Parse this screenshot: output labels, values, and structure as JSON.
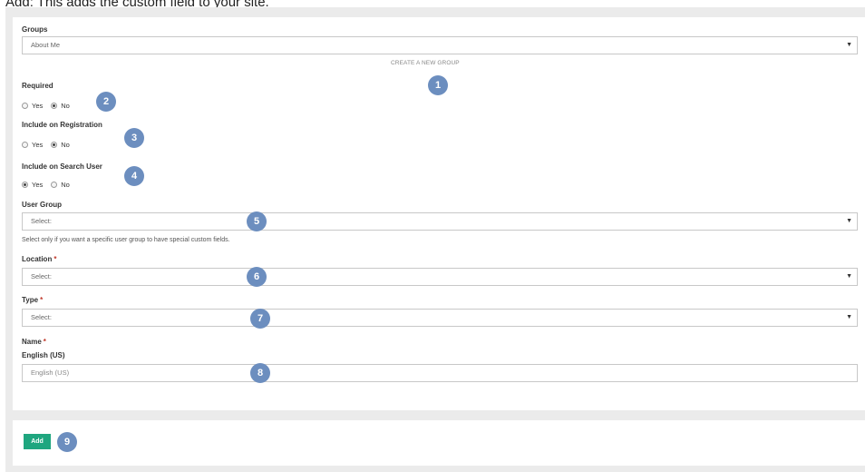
{
  "caption": "Add: This adds the custom field to your site.",
  "groups": {
    "label": "Groups",
    "selected": "About Me",
    "create_link": "CREATE A NEW GROUP"
  },
  "required": {
    "label": "Required",
    "options": [
      "Yes",
      "No"
    ],
    "selected": "No"
  },
  "include_registration": {
    "label": "Include on Registration",
    "options": [
      "Yes",
      "No"
    ],
    "selected": "No"
  },
  "include_search": {
    "label": "Include on Search User",
    "options": [
      "Yes",
      "No"
    ],
    "selected": "Yes"
  },
  "user_group": {
    "label": "User Group",
    "selected": "Select:",
    "help": "Select only if you want a specific user group to have special custom fields."
  },
  "location": {
    "label": "Location",
    "required_mark": "*",
    "selected": "Select:"
  },
  "type": {
    "label": "Type",
    "required_mark": "*",
    "selected": "Select:"
  },
  "name": {
    "label": "Name",
    "required_mark": "*",
    "sub_label": "English (US)",
    "placeholder": "English (US)"
  },
  "footer": {
    "add_label": "Add"
  },
  "badges": [
    "1",
    "2",
    "3",
    "4",
    "5",
    "6",
    "7",
    "8",
    "9"
  ],
  "colors": {
    "badge": "#6c8ebf",
    "add_button": "#1fa67f",
    "required_star": "#c0392b"
  }
}
